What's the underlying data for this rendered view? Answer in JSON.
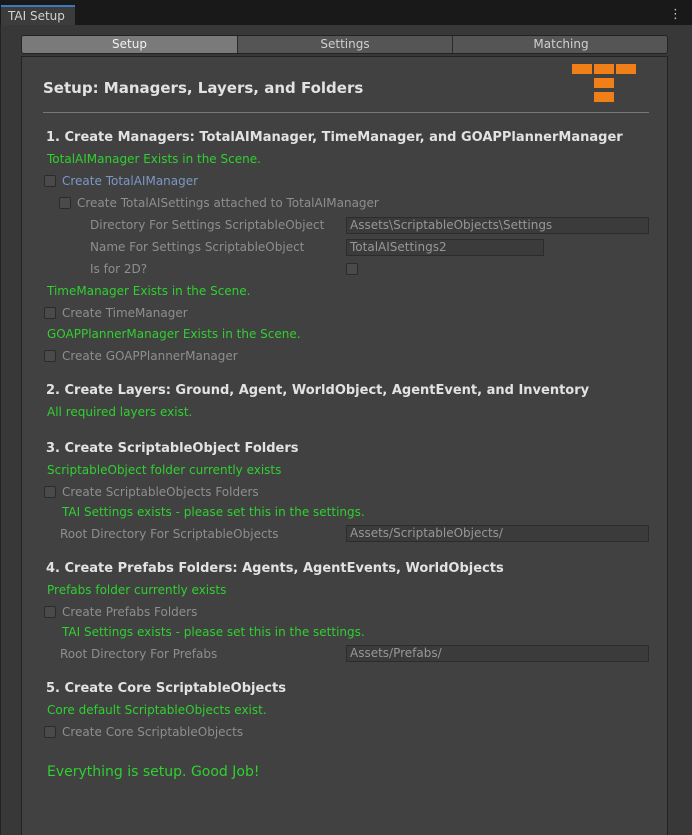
{
  "window": {
    "tab_title": "TAI Setup",
    "menu_icon": "kebab-menu-icon"
  },
  "toolbar": {
    "tabs": [
      "Setup",
      "Settings",
      "Matching"
    ],
    "active": "Setup"
  },
  "header": {
    "title": "Setup: Managers, Layers, and Folders",
    "logo": "tai-logo",
    "logo_color": "#f07f17"
  },
  "colors": {
    "success_text": "#2fd02f",
    "link_text": "#7d97c4",
    "panel_bg": "#414141",
    "active_tab_accent": "#3a79bb"
  },
  "section1": {
    "title": "1.  Create Managers: TotalAIManager, TimeManager, and GOAPPlannerManager",
    "status_totalai": "TotalAIManager Exists in the Scene.",
    "create_totalai_label": "Create TotalAIManager",
    "create_settings_label": "Create TotalAISettings attached to TotalAIManager",
    "dir_label": "Directory For Settings ScriptableObject",
    "dir_value": "Assets\\ScriptableObjects\\Settings",
    "name_label": "Name For Settings ScriptableObject",
    "name_value": "TotalAISettings2",
    "is2d_label": "Is for 2D?",
    "status_time": "TimeManager Exists in the Scene.",
    "create_time_label": "Create TimeManager",
    "status_goap": "GOAPPlannerManager Exists in the Scene.",
    "create_goap_label": "Create GOAPPlannerManager"
  },
  "section2": {
    "title": "2.  Create Layers: Ground, Agent, WorldObject, AgentEvent, and Inventory",
    "status": "All required layers exist."
  },
  "section3": {
    "title": "3.  Create ScriptableObject Folders",
    "status": "ScriptableObject folder currently exists",
    "create_label": "Create ScriptableObjects Folders",
    "note": "TAI Settings exists - please set this in the settings.",
    "root_label": "Root Directory For ScriptableObjects",
    "root_value": "Assets/ScriptableObjects/"
  },
  "section4": {
    "title": "4.  Create Prefabs Folders: Agents, AgentEvents, WorldObjects",
    "status": "Prefabs folder currently exists",
    "create_label": "Create Prefabs Folders",
    "note": "TAI Settings exists - please set this in the settings.",
    "root_label": "Root Directory For Prefabs",
    "root_value": "Assets/Prefabs/"
  },
  "section5": {
    "title": "5.  Create Core ScriptableObjects",
    "status": "Core default ScriptableObjects exist.",
    "create_label": "Create Core ScriptableObjects"
  },
  "footer": {
    "message": "Everything is setup.  Good Job!"
  }
}
